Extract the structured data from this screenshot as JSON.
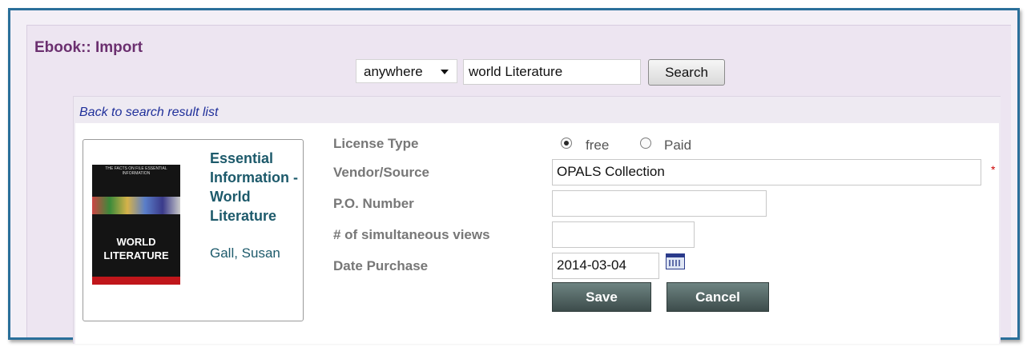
{
  "page": {
    "title": "Ebook:: Import"
  },
  "search": {
    "scope_value": "anywhere",
    "query_value": "world Literature",
    "button_label": "Search"
  },
  "detail": {
    "back_link": "Back to search result list",
    "book": {
      "cover_text_top": "THE FACTS ON FILE ESSENTIAL INFORMATION",
      "cover_title": "WORLD LITERATURE",
      "title": "Essential Information - World Literature",
      "author": "Gall, Susan"
    },
    "form": {
      "license_type_label": "License Type",
      "license_options": [
        {
          "label": "free",
          "selected": true
        },
        {
          "label": "Paid",
          "selected": false
        }
      ],
      "vendor_label": "Vendor/Source",
      "vendor_value": "OPALS Collection",
      "required_mark": "*",
      "po_label": "P.O. Number",
      "po_value": "",
      "views_label": "# of simultaneous views",
      "views_value": "",
      "date_label": "Date Purchase",
      "date_value": "2014-03-04",
      "save_label": "Save",
      "cancel_label": "Cancel"
    }
  },
  "colors": {
    "title": "#6b2f6f",
    "link": "#1f2f9a",
    "book_text": "#1d5a6b",
    "frame_border": "#2a6f9a",
    "button_dark": "#4f6160"
  }
}
